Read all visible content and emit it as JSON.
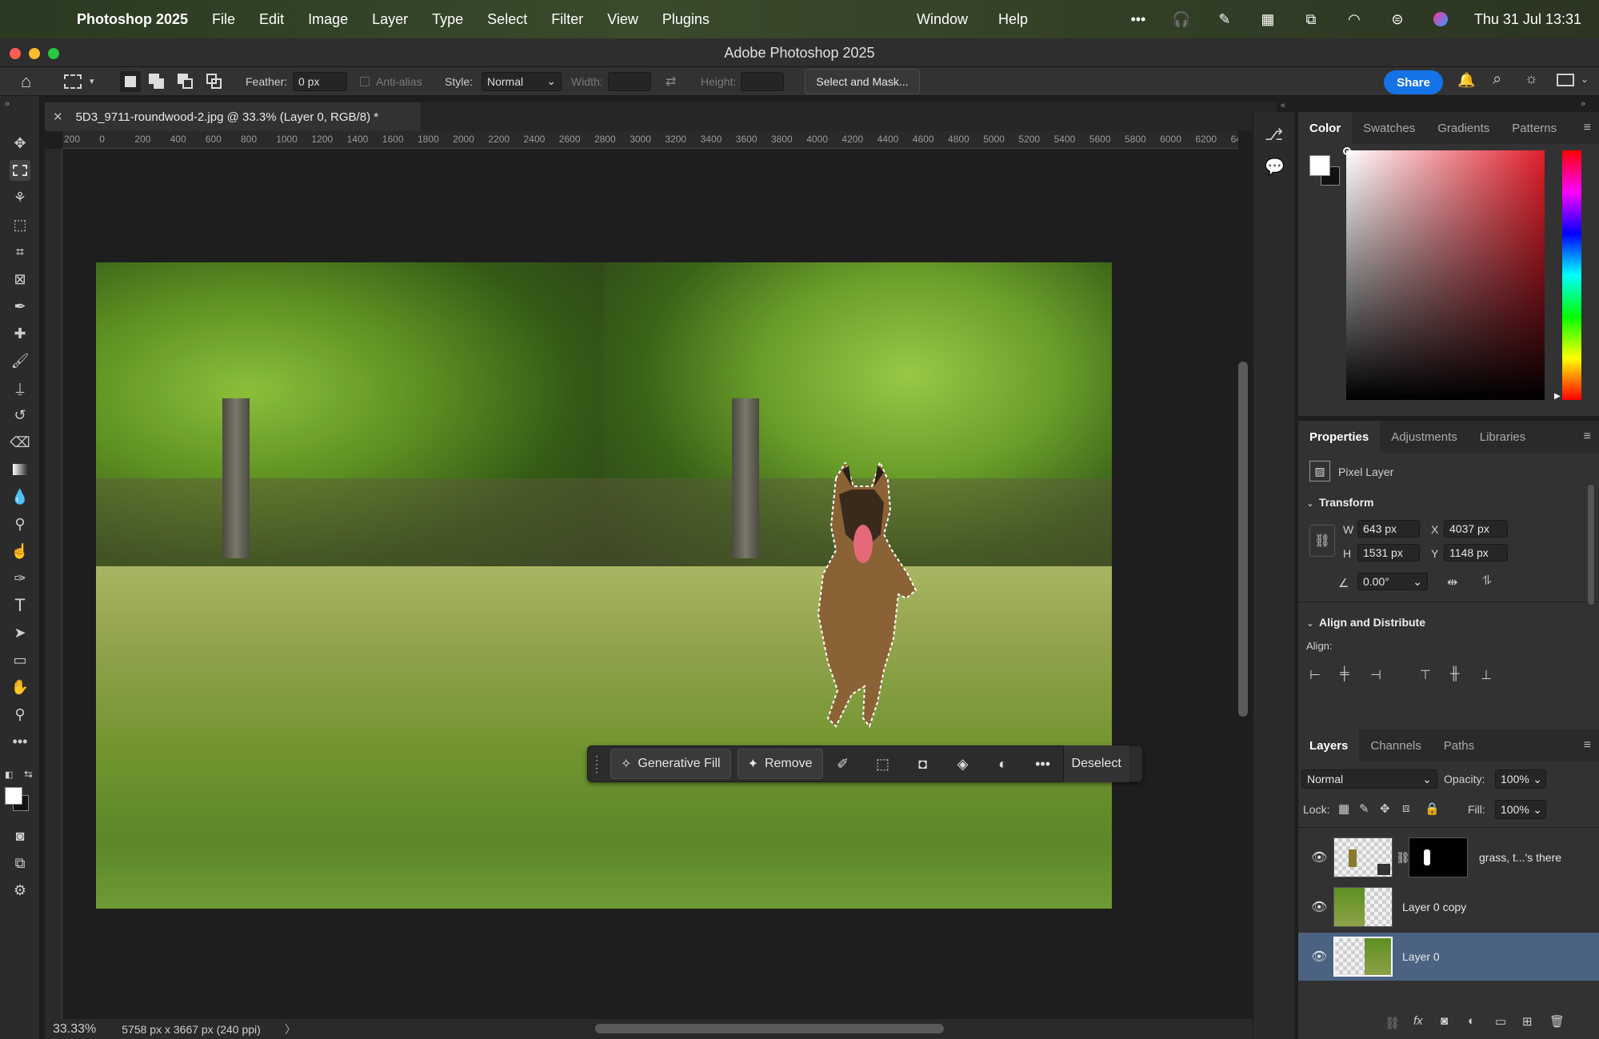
{
  "menubar": {
    "app_name": "Photoshop 2025",
    "items": [
      "File",
      "Edit",
      "Image",
      "Layer",
      "Type",
      "Select",
      "Filter",
      "View",
      "Plugins"
    ],
    "right_items": [
      "Window",
      "Help"
    ],
    "clock": "Thu 31 Jul  13:31"
  },
  "window": {
    "title": "Adobe Photoshop 2025"
  },
  "options": {
    "feather_label": "Feather:",
    "feather_value": "0 px",
    "antialias_label": "Anti-alias",
    "style_label": "Style:",
    "style_value": "Normal",
    "width_label": "Width:",
    "height_label": "Height:",
    "select_mask_label": "Select and Mask...",
    "share_label": "Share"
  },
  "document": {
    "tab_title": "5D3_9711-roundwood-2.jpg @ 33.3% (Layer 0, RGB/8) *",
    "zoom": "33.33%",
    "info": "5758 px x 3667 px (240 ppi)"
  },
  "ruler": {
    "ticks": [
      "200",
      "0",
      "200",
      "400",
      "600",
      "800",
      "1000",
      "1200",
      "1400",
      "1600",
      "1800",
      "2000",
      "2200",
      "2400",
      "2600",
      "2800",
      "3000",
      "3200",
      "3400",
      "3600",
      "3800",
      "4000",
      "4200",
      "4400",
      "4600",
      "4800",
      "5000",
      "5200",
      "5400",
      "5600",
      "5800",
      "6000",
      "6200",
      "64"
    ]
  },
  "contextbar": {
    "generative_fill": "Generative Fill",
    "remove": "Remove",
    "deselect": "Deselect"
  },
  "color_panel": {
    "tabs": [
      "Color",
      "Swatches",
      "Gradients",
      "Patterns"
    ],
    "active_tab": "Color"
  },
  "properties_panel": {
    "tabs": [
      "Properties",
      "Adjustments",
      "Libraries"
    ],
    "layer_type": "Pixel Layer",
    "transform_title": "Transform",
    "w_label": "W",
    "w_value": "643 px",
    "h_label": "H",
    "h_value": "1531 px",
    "x_label": "X",
    "x_value": "4037 px",
    "y_label": "Y",
    "y_value": "1148 px",
    "angle_value": "0.00°",
    "align_title": "Align and Distribute",
    "align_label": "Align:"
  },
  "layers_panel": {
    "tabs": [
      "Layers",
      "Channels",
      "Paths"
    ],
    "blend_mode": "Normal",
    "opacity_label": "Opacity:",
    "opacity_value": "100%",
    "lock_label": "Lock:",
    "fill_label": "Fill:",
    "fill_value": "100%",
    "layers": [
      {
        "name": "grass, t...'s there",
        "selected": false
      },
      {
        "name": "Layer 0 copy",
        "selected": false
      },
      {
        "name": "Layer 0",
        "selected": true
      }
    ]
  },
  "colors": {
    "accent": "#1473e6",
    "selected_layer": "#4b6282"
  }
}
